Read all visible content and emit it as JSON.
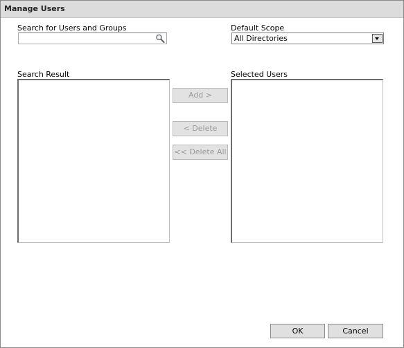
{
  "dialog": {
    "title": "Manage Users"
  },
  "search": {
    "label": "Search for Users and Groups",
    "value": "",
    "placeholder": "",
    "icon": "search-icon"
  },
  "scope": {
    "label": "Default Scope",
    "selected": "All Directories"
  },
  "search_result": {
    "label": "Search Result",
    "items": []
  },
  "selected_users": {
    "label": "Selected Users",
    "items": []
  },
  "actions": {
    "add_label": "Add >",
    "delete_label": "< Delete",
    "delete_all_label": "<< Delete All"
  },
  "footer": {
    "ok_label": "OK",
    "cancel_label": "Cancel"
  }
}
